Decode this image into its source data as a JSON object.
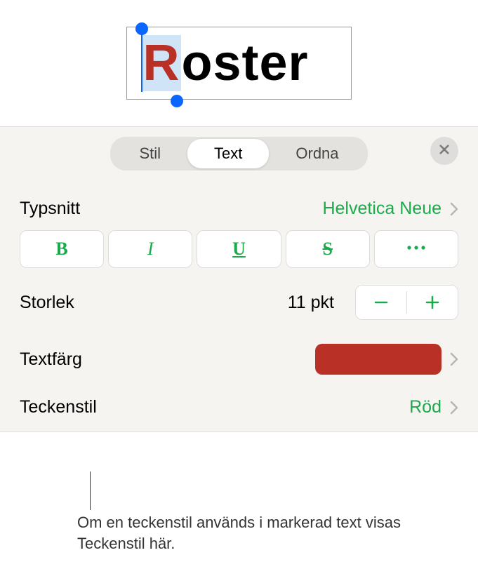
{
  "canvas": {
    "word_rest": "oster",
    "first_letter": "R"
  },
  "tabs": {
    "stil": "Stil",
    "text": "Text",
    "ordna": "Ordna"
  },
  "close_icon": "close",
  "font": {
    "label": "Typsnitt",
    "value": "Helvetica Neue"
  },
  "style_buttons": {
    "bold": "B",
    "italic": "I",
    "underline": "U",
    "strike": "S",
    "more": "more"
  },
  "size": {
    "label": "Storlek",
    "value": "11 pkt"
  },
  "text_color": {
    "label": "Textfärg",
    "swatch": "#b93026"
  },
  "char_style": {
    "label": "Teckenstil",
    "value": "Röd"
  },
  "callout": "Om en teckenstil används i markerad text visas Teckenstil här."
}
